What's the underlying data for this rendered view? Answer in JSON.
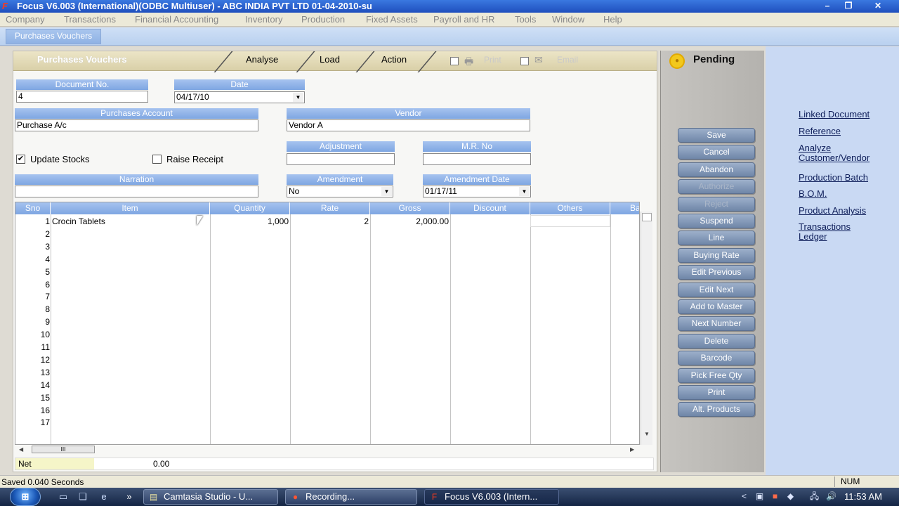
{
  "window": {
    "title": "Focus V6.003 (International)(ODBC Multiuser) - ABC INDIA PVT LTD 01-04-2010-su",
    "controls": {
      "minimize": "–",
      "restore": "❐",
      "close": "✕"
    }
  },
  "menu": [
    "Company",
    "Transactions",
    "Financial Accounting",
    "Inventory",
    "Production",
    "Fixed Assets",
    "Payroll and HR",
    "Tools",
    "Window",
    "Help"
  ],
  "doc_tab": "Purchases Vouchers",
  "header": {
    "title": "Purchases Vouchers",
    "analyse": "Analyse",
    "load": "Load",
    "action": "Action",
    "print": "Print",
    "email": "Email"
  },
  "form": {
    "document_no": {
      "label": "Document No.",
      "value": "4"
    },
    "date": {
      "label": "Date",
      "value": "04/17/10"
    },
    "purchases_account": {
      "label": "Purchases Account",
      "value": "Purchase A/c"
    },
    "vendor": {
      "label": "Vendor",
      "value": "Vendor A"
    },
    "update_stocks": {
      "label": "Update Stocks",
      "checked": true,
      "mark": "✔"
    },
    "raise_receipt": {
      "label": "Raise Receipt",
      "checked": false
    },
    "adjustment": {
      "label": "Adjustment",
      "value": ""
    },
    "mr_no": {
      "label": "M.R. No",
      "value": ""
    },
    "narration": {
      "label": "Narration",
      "value": ""
    },
    "amendment": {
      "label": "Amendment",
      "value": "No"
    },
    "amendment_date": {
      "label": "Amendment Date",
      "value": "01/17/11"
    }
  },
  "grid": {
    "columns": [
      "Sno",
      "Item",
      "Quantity",
      "Rate",
      "Gross",
      "Discount",
      "Others",
      "Ba"
    ],
    "rows": [
      {
        "sno": "1",
        "item": "Crocin Tablets",
        "quantity": "1,000",
        "rate": "2",
        "gross": "2,000.00"
      },
      {
        "sno": "2"
      },
      {
        "sno": "3"
      },
      {
        "sno": "4"
      },
      {
        "sno": "5"
      },
      {
        "sno": "6"
      },
      {
        "sno": "7"
      },
      {
        "sno": "8"
      },
      {
        "sno": "9"
      },
      {
        "sno": "10"
      },
      {
        "sno": "11"
      },
      {
        "sno": "12"
      },
      {
        "sno": "13"
      },
      {
        "sno": "14"
      },
      {
        "sno": "15"
      },
      {
        "sno": "16"
      },
      {
        "sno": "17"
      }
    ],
    "hscroll_thumb": "III"
  },
  "net": {
    "label": "Net",
    "value": "0.00"
  },
  "status_panel": {
    "pending": "Pending"
  },
  "actions": [
    {
      "label": "Save",
      "enabled": true
    },
    {
      "label": "Cancel",
      "enabled": true
    },
    {
      "label": "Abandon",
      "enabled": true
    },
    {
      "label": "Authorize",
      "enabled": false
    },
    {
      "label": "Reject",
      "enabled": false
    },
    {
      "label": "Suspend",
      "enabled": true
    },
    {
      "label": "Line",
      "enabled": true
    },
    {
      "label": "Buying Rate",
      "enabled": true
    },
    {
      "label": "Edit Previous",
      "enabled": true
    },
    {
      "label": "Edit Next",
      "enabled": true
    },
    {
      "label": "Add to Master",
      "enabled": true
    },
    {
      "label": "Next Number",
      "enabled": true
    },
    {
      "label": "Delete",
      "enabled": true
    },
    {
      "label": "Barcode",
      "enabled": true
    },
    {
      "label": "Pick Free Qty",
      "enabled": true
    },
    {
      "label": "Print",
      "enabled": true
    },
    {
      "label": "Alt. Products",
      "enabled": true
    }
  ],
  "links": [
    {
      "line1": "Linked Document"
    },
    {
      "line1": "Reference"
    },
    {
      "line1": "Analyze",
      "line2": "Customer/Vendor"
    },
    {
      "line1": "Production Batch"
    },
    {
      "line1": "B.O.M."
    },
    {
      "line1": "Product Analysis"
    },
    {
      "line1": "Transactions",
      "line2": "Ledger"
    }
  ],
  "statusbar": {
    "text": "Saved 0.040 Seconds",
    "num": "NUM"
  },
  "taskbar": {
    "overflow": "»",
    "buttons": [
      {
        "label": "Camtasia Studio - U...",
        "icon": "camtasia-icon"
      },
      {
        "label": "Recording...",
        "icon": "recording-icon"
      },
      {
        "label": "Focus V6.003 (Intern...",
        "icon": "focus-icon"
      }
    ],
    "tray_chevron": "<",
    "clock": "11:53 AM"
  }
}
